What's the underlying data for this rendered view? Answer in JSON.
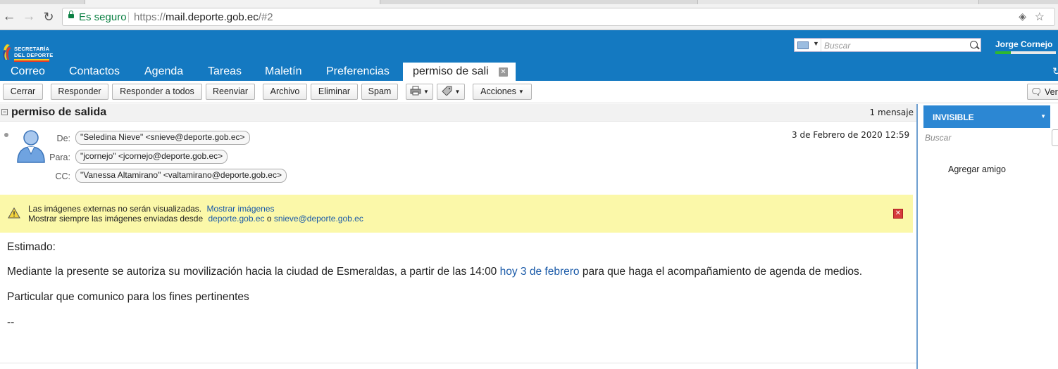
{
  "browser": {
    "security_label": "Es seguro",
    "url_scheme": "https://",
    "url_domain": "mail.deporte.gob.ec",
    "url_path": "/#2"
  },
  "app": {
    "logo_line1": "SECRETARÍA",
    "logo_line2": "DEL DEPORTE",
    "search_placeholder": "Buscar",
    "user_name": "Jorge Cornejo",
    "quota_fraction": 0.25,
    "tabs": [
      {
        "label": "Correo"
      },
      {
        "label": "Contactos"
      },
      {
        "label": "Agenda"
      },
      {
        "label": "Tareas"
      },
      {
        "label": "Maletín"
      },
      {
        "label": "Preferencias"
      }
    ],
    "active_tab": "permiso de sali"
  },
  "toolbar": {
    "close": "Cerrar",
    "reply": "Responder",
    "reply_all": "Responder a todos",
    "forward": "Reenviar",
    "archive": "Archivo",
    "delete": "Eliminar",
    "spam": "Spam",
    "actions": "Acciones",
    "view": "Ver"
  },
  "conversation": {
    "title": "permiso de salida",
    "count": "1 mensaje"
  },
  "message": {
    "from_label": "De:",
    "to_label": "Para:",
    "cc_label": "CC:",
    "from": "\"Seledina Nieve\" <snieve@deporte.gob.ec>",
    "to": "\"jcornejo\" <jcornejo@deporte.gob.ec>",
    "cc": "\"Vanessa Altamirano\" <valtamirano@deporte.gob.ec>",
    "date": "3 de Febrero de 2020 12:59"
  },
  "warning": {
    "line1": "Las imágenes externas no serán visualizadas.",
    "show_images": "Mostrar imágenes",
    "line2": "Mostrar siempre las imágenes enviadas desde",
    "domain": "deporte.gob.ec",
    "or": "o",
    "sender": "snieve@deporte.gob.ec"
  },
  "body": {
    "greeting": "Estimado:",
    "para1_start": "Mediante la presente se autoriza su movilización hacia la ciudad de Esmeraldas, a partir de las 14:00",
    "para1_link": "hoy 3 de febrero",
    "para1_end": "para que haga el acompañamiento de agenda de medios.",
    "para2": "Particular que comunico para los fines pertinentes",
    "signature": "--"
  },
  "chat": {
    "status": "INVISIBLE",
    "search_placeholder": "Buscar",
    "add_friend": "Agregar amigo"
  },
  "colors": {
    "header_blue": "#1479c1",
    "warning_yellow": "#fbf8a9",
    "link_blue": "#1a5aa8",
    "status_blue": "#2c87d3"
  }
}
